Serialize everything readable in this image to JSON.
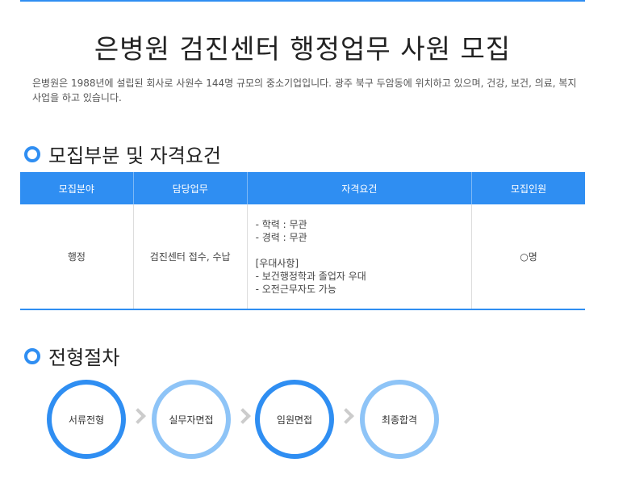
{
  "page": {
    "title": "은병원 검진센터 행정업무 사원 모집",
    "intro": "은병원은 1988년에 설립된 회사로 사원수 144명 규모의 중소기업입니다. 광주 북구 두암동에 위치하고 있으며, 건강, 보건, 의료, 복지사업을 하고 있습니다."
  },
  "section1": {
    "title": "모집부분 및 자격요건",
    "headers": [
      "모집분야",
      "담당업무",
      "자격요건",
      "모집인원"
    ],
    "row": {
      "field": "행정",
      "duty": "검진센터 접수, 수납",
      "req_lines": [
        "- 학력 : 무관",
        "- 경력 : 무관",
        "",
        "[우대사항]",
        "- 보건행정학과 졸업자 우대",
        "- 오전근무자도 가능"
      ],
      "count": "○명"
    }
  },
  "section2": {
    "title": "전형절차",
    "steps": [
      "서류전형",
      "실무자면접",
      "임원면접",
      "최종합격"
    ]
  },
  "colors": {
    "accent": "#2f8ef2",
    "accent_light": "#8ec4f7"
  }
}
